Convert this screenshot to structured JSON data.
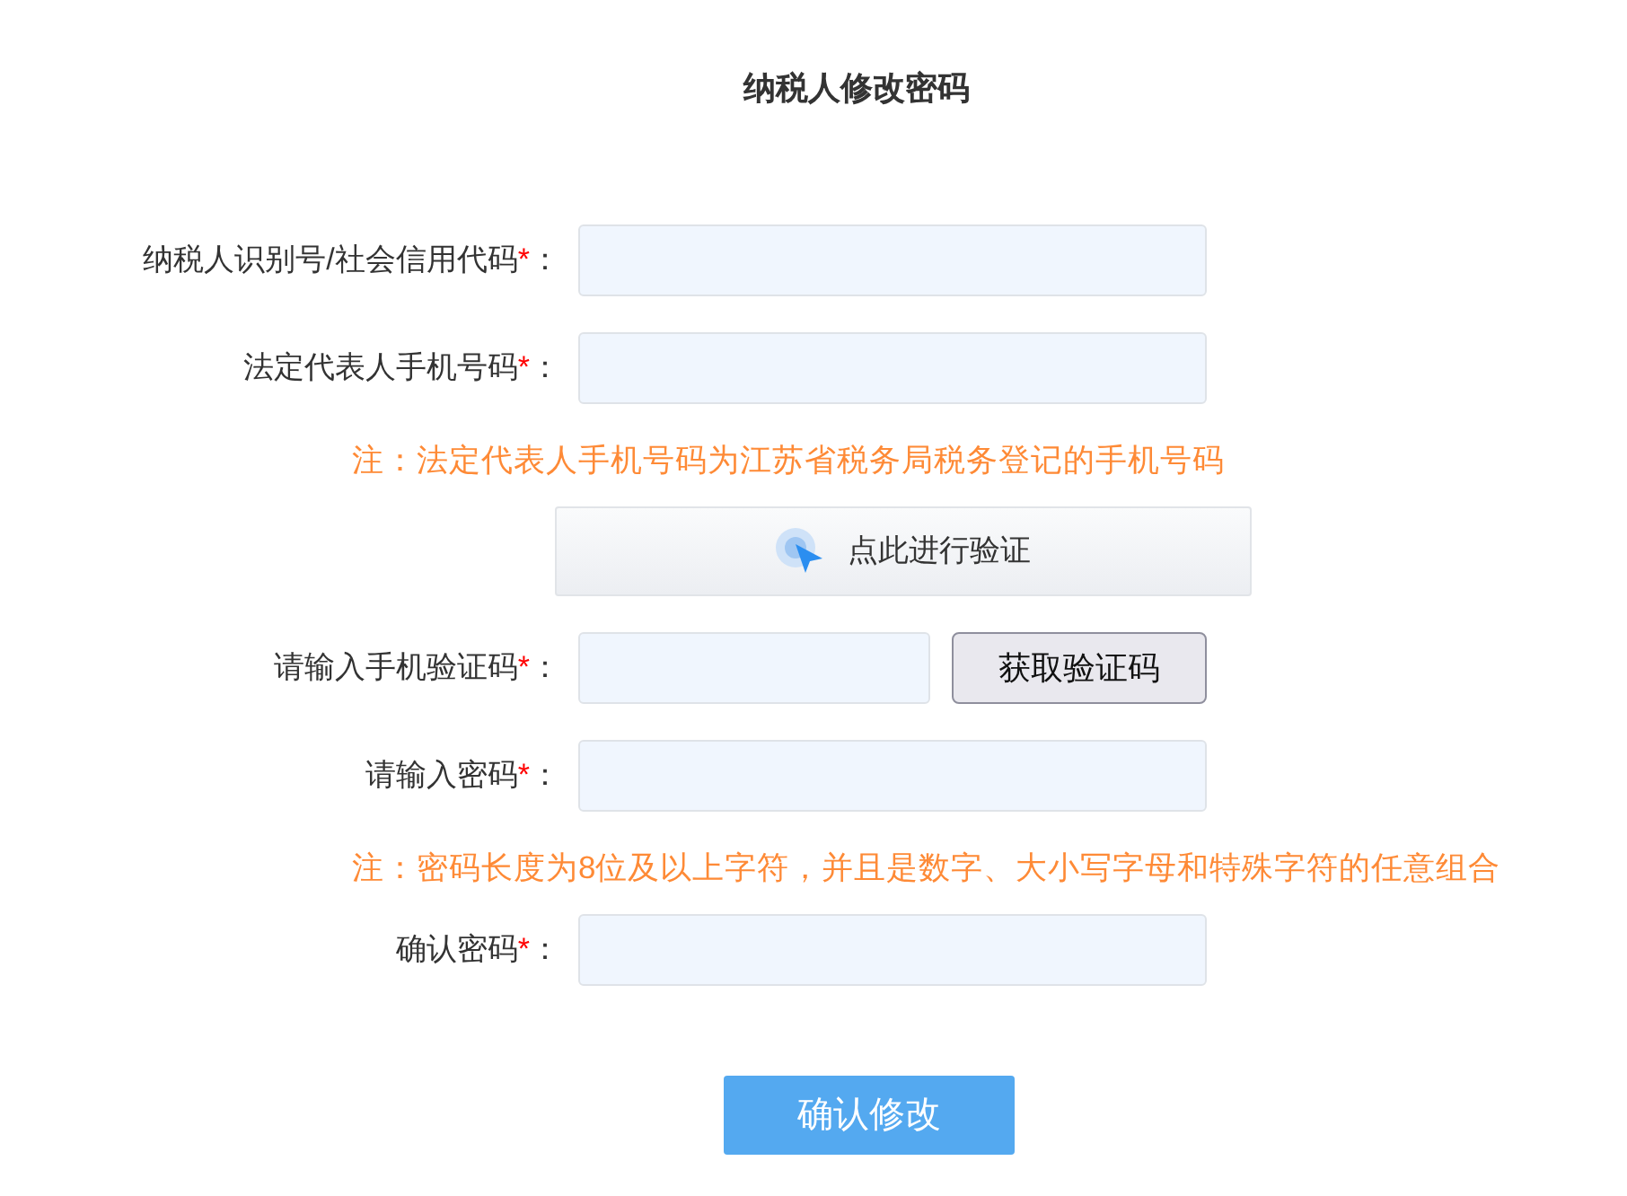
{
  "title": "纳税人修改密码",
  "rows": [
    {
      "kind": "input",
      "label": "纳税人识别号/社会信用代码",
      "required_mark": "*",
      "colon": "："
    },
    {
      "kind": "input",
      "label": "法定代表人手机号码",
      "required_mark": "*",
      "colon": "："
    },
    {
      "kind": "note",
      "text": "注：法定代表人手机号码为江苏省税务局税务登记的手机号码"
    },
    {
      "kind": "verify",
      "text": "点此进行验证"
    },
    {
      "kind": "input_with_button",
      "label": "请输入手机验证码",
      "required_mark": "*",
      "colon": "：",
      "button": "获取验证码"
    },
    {
      "kind": "input",
      "label": "请输入密码",
      "required_mark": "*",
      "colon": "："
    },
    {
      "kind": "note",
      "text": "注：密码长度为8位及以上字符，并且是数字、大小写字母和特殊字符的任意组合"
    },
    {
      "kind": "input",
      "label": "确认密码",
      "required_mark": "*",
      "colon": "："
    }
  ],
  "submit": "确认修改"
}
